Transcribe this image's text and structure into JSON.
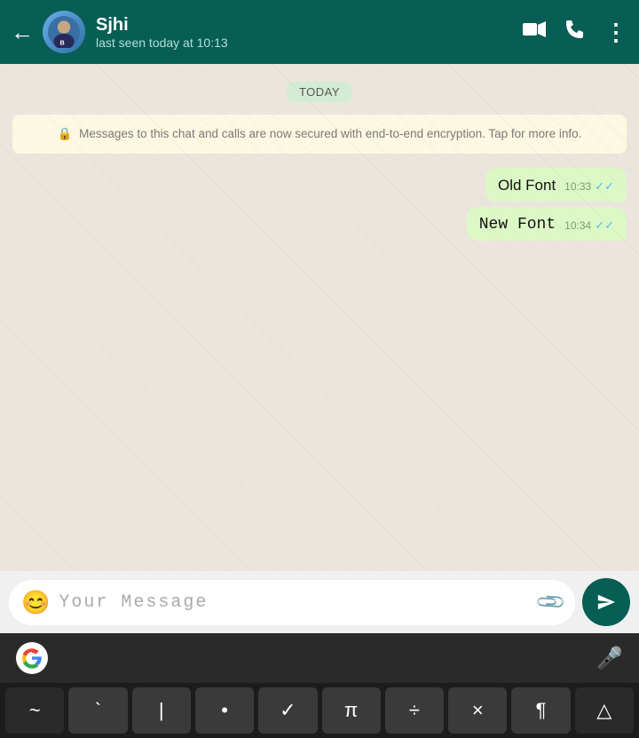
{
  "header": {
    "back_label": "←",
    "name": "Sjhi",
    "status": "last seen today at 10:13",
    "video_icon": "video-camera-icon",
    "phone_icon": "phone-icon",
    "more_icon": "more-options-icon"
  },
  "chat": {
    "date_badge": "TODAY",
    "security_notice": "Messages to this chat and calls are now secured with end-to-end encryption. Tap for more info.",
    "messages": [
      {
        "text": "Old Font",
        "time": "10:33",
        "font": "normal"
      },
      {
        "text": "New Font",
        "time": "10:34",
        "font": "monospace"
      }
    ]
  },
  "input": {
    "emoji_label": "😊",
    "placeholder": "Your Message",
    "attach_label": "📎",
    "send_label": "▶"
  },
  "keyboard": {
    "keys": [
      "~",
      "`",
      "|",
      "•",
      "✓",
      "π",
      "÷",
      "×",
      "¶",
      "△"
    ]
  }
}
